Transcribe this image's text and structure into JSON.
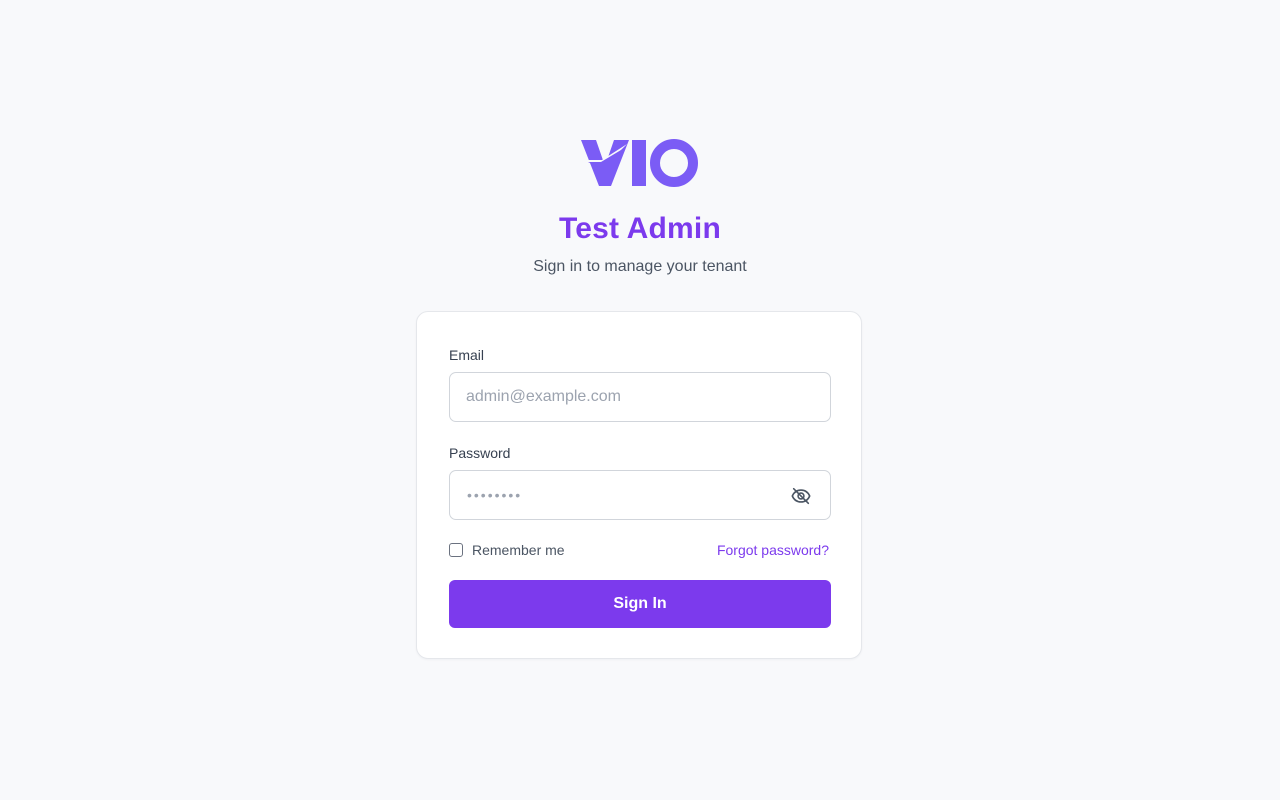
{
  "brand": {
    "logo_text": "VIO",
    "accent_color": "#7c3aed",
    "logo_color": "#7b5cf5"
  },
  "header": {
    "title": "Test Admin",
    "subtitle": "Sign in to manage your tenant"
  },
  "form": {
    "email": {
      "label": "Email",
      "placeholder": "admin@example.com",
      "value": ""
    },
    "password": {
      "label": "Password",
      "masked_value": "••••••••",
      "visibility_icon": "eye-off-icon"
    },
    "remember": {
      "label": "Remember me",
      "checked": false
    },
    "forgot_label": "Forgot password?",
    "submit_label": "Sign In"
  }
}
